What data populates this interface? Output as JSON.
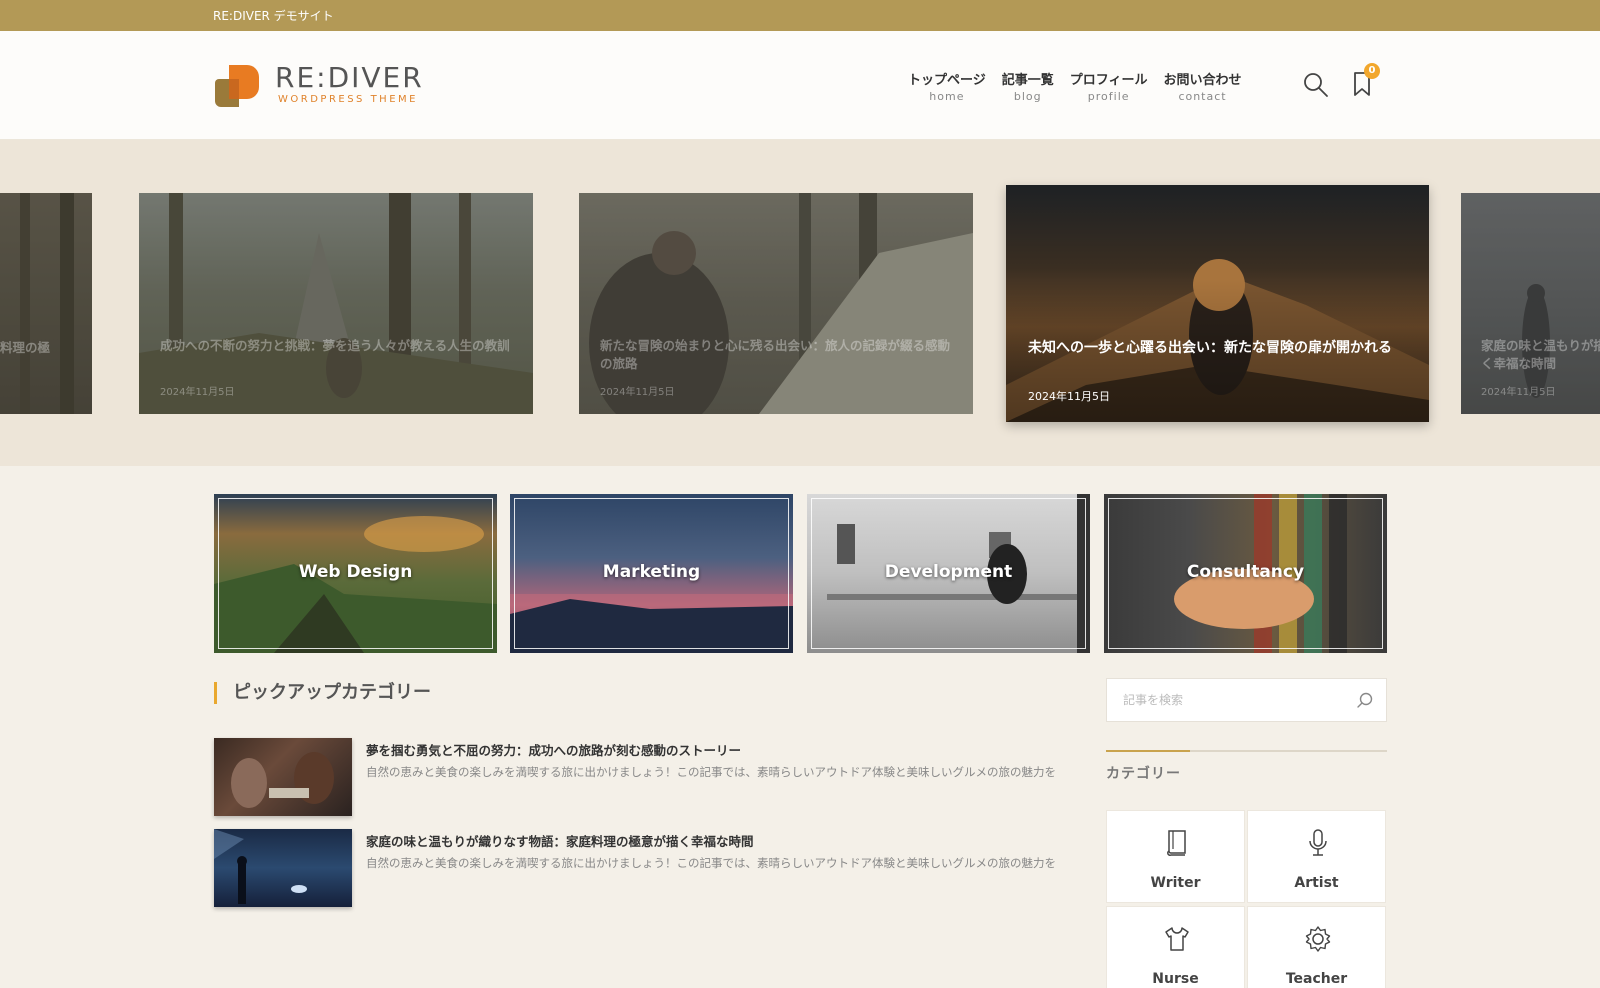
{
  "topbar": {
    "site_name": "RE:DIVER デモサイト"
  },
  "header": {
    "logo_text": "RE:DIVER",
    "logo_sub": "WORDPRESS THEME",
    "nav": [
      {
        "jp": "トップページ",
        "en": "home"
      },
      {
        "jp": "記事一覧",
        "en": "blog"
      },
      {
        "jp": "プロフィール",
        "en": "profile"
      },
      {
        "jp": "お問い合わせ",
        "en": "contact"
      }
    ],
    "bookmark_count": "0"
  },
  "slider": [
    {
      "title": "料理の極",
      "date": ""
    },
    {
      "title": "成功への不断の努力と挑戦：夢を追う人々が教える人生の教訓",
      "date": "2024年11月5日"
    },
    {
      "title": "新たな冒険の始まりと心に残る出会い：旅人の記録が綴る感動の旅路",
      "date": "2024年11月5日"
    },
    {
      "title": "未知への一歩と心躍る出会い：新たな冒険の扉が開かれる",
      "date": "2024年11月5日"
    },
    {
      "title": "家庭の味と温もりが描く幸福な時間",
      "date": "2024年11月5日"
    }
  ],
  "categories": [
    {
      "label": "Web Design"
    },
    {
      "label": "Marketing"
    },
    {
      "label": "Development"
    },
    {
      "label": "Consultancy"
    }
  ],
  "pickup": {
    "title": "ピックアップカテゴリー",
    "posts": [
      {
        "title": "夢を掴む勇気と不屈の努力：成功への旅路が刻む感動のストーリー",
        "excerpt": "自然の恵みと美食の楽しみを満喫する旅に出かけましょう！この記事では、素晴らしいアウトドア体験と美味しいグルメの旅の魅力を"
      },
      {
        "title": "家庭の味と温もりが織りなす物語：家庭料理の極意が描く幸福な時間",
        "excerpt": "自然の恵みと美食の楽しみを満喫する旅に出かけましょう！この記事では、素晴らしいアウトドア体験と美味しいグルメの旅の魅力を"
      }
    ]
  },
  "sidebar": {
    "search_placeholder": "記事を検索",
    "category_title": "カテゴリー",
    "category_cards": [
      {
        "label": "Writer",
        "icon": "book-icon"
      },
      {
        "label": "Artist",
        "icon": "microphone-icon"
      },
      {
        "label": "Nurse",
        "icon": "tshirt-icon"
      },
      {
        "label": "Teacher",
        "icon": "gear-icon"
      }
    ]
  },
  "colors": {
    "topbar": "#b39956",
    "accent_orange": "#e0832c",
    "badge": "#f2a72c",
    "section_accent": "#e9a82e"
  }
}
